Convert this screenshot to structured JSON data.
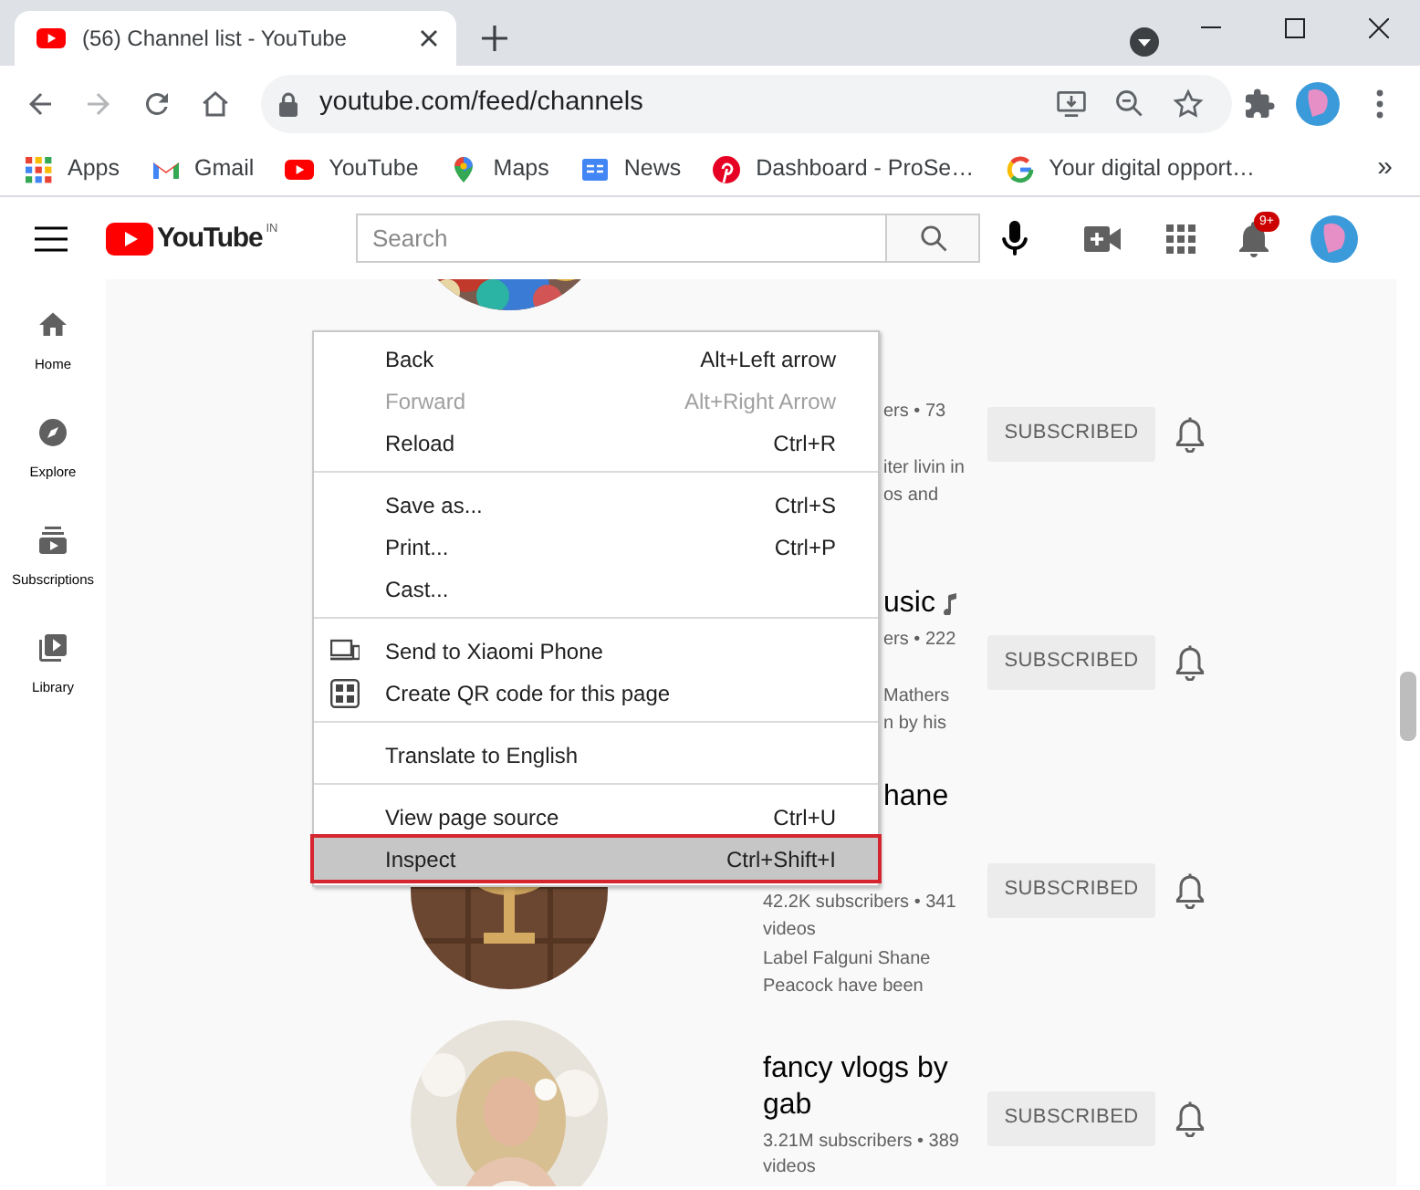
{
  "browser": {
    "tab": {
      "title": "(56) Channel list - YouTube",
      "selected": true
    },
    "nav": [
      {
        "kind": "back",
        "disabled": false
      },
      {
        "kind": "forward",
        "disabled": true
      },
      {
        "kind": "reload",
        "disabled": false
      },
      {
        "kind": "home",
        "disabled": false
      }
    ],
    "address": "youtube.com/feed/channels",
    "bookmarks": [
      {
        "kind": "apps",
        "label": "Apps"
      },
      {
        "kind": "gmail",
        "label": "Gmail"
      },
      {
        "kind": "youtube",
        "label": "YouTube"
      },
      {
        "kind": "maps",
        "label": "Maps"
      },
      {
        "kind": "news",
        "label": "News"
      },
      {
        "kind": "pinterest",
        "label": "Dashboard - ProSe…"
      },
      {
        "kind": "google",
        "label": "Your digital opport…"
      }
    ],
    "bookmarks_overflow": "»"
  },
  "youtube": {
    "logo": "YouTube",
    "region": "IN",
    "search": {
      "placeholder": "Search"
    },
    "notifications": "9+",
    "sidebar": [
      {
        "kind": "home",
        "label": "Home"
      },
      {
        "kind": "explore",
        "label": "Explore"
      },
      {
        "kind": "subscriptions",
        "label": "Subscriptions"
      },
      {
        "kind": "library",
        "label": "Library"
      }
    ],
    "channels": [
      {
        "stats": {
          "lines": [
            "ers • 73"
          ],
          "partial": true
        },
        "description": {
          "lines": [
            "iter livin in",
            "os and"
          ],
          "partial": true
        },
        "button": "SUBSCRIBED",
        "subscribed": true
      },
      {
        "name": {
          "text": "usic",
          "partial": true,
          "official_artist": true
        },
        "stats": {
          "lines": [
            "ers • 222"
          ],
          "partial": true
        },
        "description": {
          "lines": [
            "Mathers",
            "n by his"
          ],
          "partial": true
        },
        "button": "SUBSCRIBED",
        "subscribed": true
      },
      {
        "name": {
          "text": "hane",
          "partial": true,
          "official_artist": false,
          "wrapped": true
        },
        "stats": {
          "lines": [
            "42.2K subscribers • 341",
            "videos"
          ],
          "partial": false
        },
        "description": {
          "lines": [
            "Label Falguni Shane",
            "Peacock have been"
          ],
          "partial": false
        },
        "button": "SUBSCRIBED",
        "subscribed": true
      },
      {
        "name": {
          "text": "fancy vlogs by gab",
          "partial": false,
          "official_artist": false
        },
        "stats": {
          "lines": [
            "3.21M subscribers • 389",
            "videos"
          ],
          "partial": false
        },
        "button": "SUBSCRIBED",
        "subscribed": true
      }
    ]
  },
  "context_menu": [
    {
      "kind": "item",
      "label": "Back",
      "shortcut": "Alt+Left arrow",
      "disabled": false,
      "selected": false
    },
    {
      "kind": "item",
      "label": "Forward",
      "shortcut": "Alt+Right Arrow",
      "disabled": true,
      "selected": false
    },
    {
      "kind": "item",
      "label": "Reload",
      "shortcut": "Ctrl+R",
      "disabled": false,
      "selected": false
    },
    {
      "kind": "separator"
    },
    {
      "kind": "item",
      "label": "Save as...",
      "shortcut": "Ctrl+S",
      "disabled": false,
      "selected": false
    },
    {
      "kind": "item",
      "label": "Print...",
      "shortcut": "Ctrl+P",
      "disabled": false,
      "selected": false
    },
    {
      "kind": "item",
      "label": "Cast...",
      "disabled": false,
      "selected": false
    },
    {
      "kind": "separator"
    },
    {
      "kind": "device",
      "label": "Send to Xiaomi Phone",
      "disabled": false,
      "selected": false
    },
    {
      "kind": "qr",
      "label": "Create QR code for this page",
      "disabled": false,
      "selected": false
    },
    {
      "kind": "separator"
    },
    {
      "kind": "item",
      "label": "Translate to English",
      "disabled": false,
      "selected": false
    },
    {
      "kind": "separator"
    },
    {
      "kind": "item",
      "label": "View page source",
      "shortcut": "Ctrl+U",
      "disabled": false,
      "selected": false
    },
    {
      "kind": "item",
      "label": "Inspect",
      "shortcut": "Ctrl+Shift+I",
      "disabled": false,
      "selected": true
    }
  ]
}
